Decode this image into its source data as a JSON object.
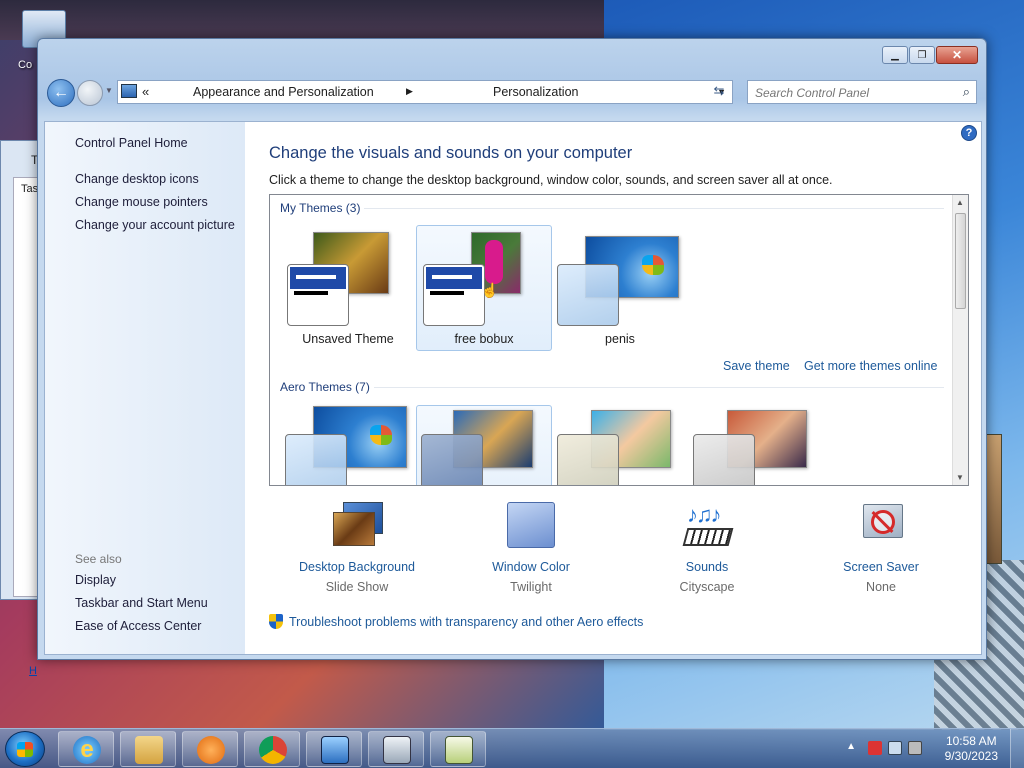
{
  "desktop": {
    "icon_label": "Co"
  },
  "background_window": {
    "title": "T",
    "tab_label": "Tas",
    "link": "H"
  },
  "window": {
    "caption": {
      "minimize": "",
      "maximize": "",
      "close": "✕"
    },
    "address": {
      "overflow": "«",
      "crumbs": [
        "Appearance and Personalization",
        "Personalization"
      ],
      "separator": "▶",
      "dropdown": "▼"
    },
    "search": {
      "placeholder": "Search Control Panel"
    }
  },
  "left_pane": {
    "links": [
      "Control Panel Home",
      "Change desktop icons",
      "Change mouse pointers",
      "Change your account picture"
    ],
    "see_also_header": "See also",
    "see_also": [
      "Display",
      "Taskbar and Start Menu",
      "Ease of Access Center"
    ]
  },
  "main": {
    "help": "?",
    "title": "Change the visuals and sounds on your computer",
    "subtitle": "Click a theme to change the desktop background, window color, sounds, and screen saver all at once.",
    "my_themes_header": "My Themes (3)",
    "my_themes": [
      {
        "name": "Unsaved Theme",
        "style": "basic"
      },
      {
        "name": "free bobux",
        "style": "basic",
        "selected": true
      },
      {
        "name": "penis",
        "style": "aero"
      }
    ],
    "save_theme": "Save theme",
    "get_more": "Get more themes online",
    "aero_themes_header": "Aero Themes (7)",
    "scroll_up": "▲",
    "scroll_down": "▼"
  },
  "bottom": {
    "items": [
      {
        "name": "Desktop Background",
        "value": "Slide Show",
        "icon": "desktop-background-icon"
      },
      {
        "name": "Window Color",
        "value": "Twilight",
        "icon": "window-color-icon"
      },
      {
        "name": "Sounds",
        "value": "Cityscape",
        "icon": "sounds-icon"
      },
      {
        "name": "Screen Saver",
        "value": "None",
        "icon": "screen-saver-icon"
      }
    ],
    "troubleshoot": "Troubleshoot problems with transparency and other Aero effects"
  },
  "taskbar": {
    "pinned": [
      "internet-explorer-icon",
      "windows-explorer-icon",
      "media-player-icon",
      "chrome-icon",
      "control-panel-icon",
      "task-manager-icon",
      "notepad-plus-icon"
    ],
    "tray_arrow": "▲",
    "time": "10:58 AM",
    "date": "9/30/2023"
  },
  "colors": {
    "accent": "#1f3e7a",
    "link": "#1e5a9a",
    "selection": "#a6c7ea"
  }
}
